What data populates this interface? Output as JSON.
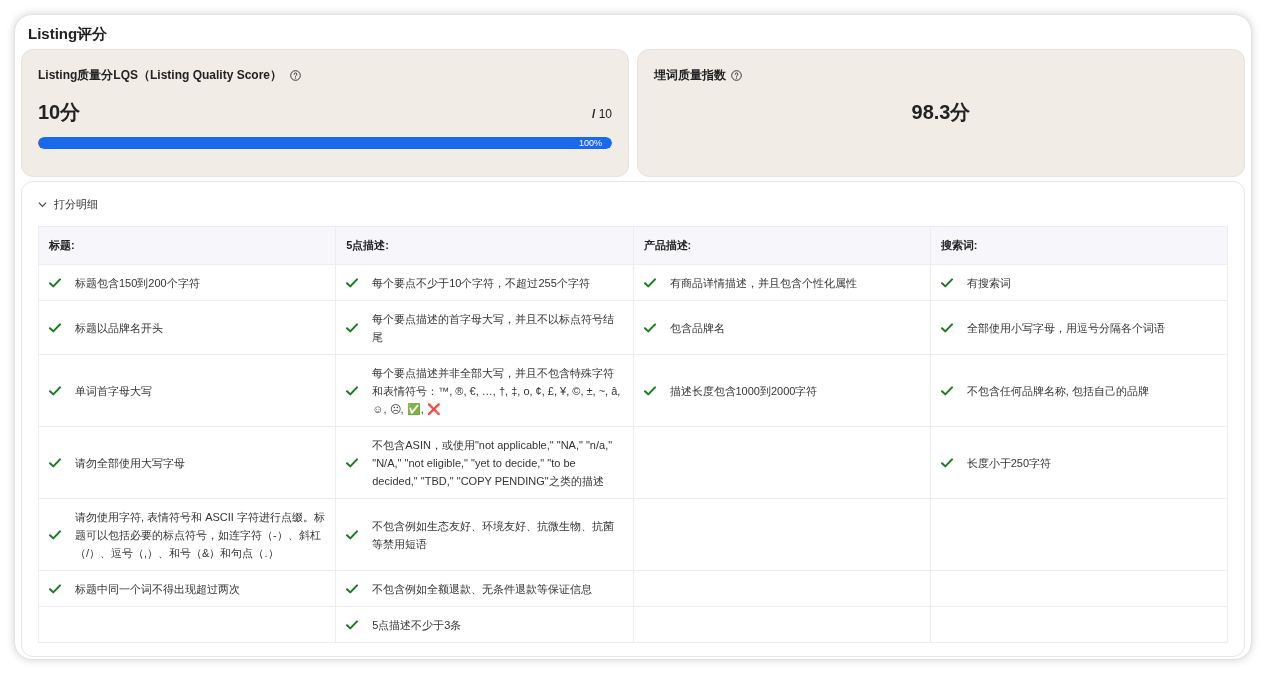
{
  "section_title": "Listing评分",
  "score_cards": [
    {
      "kind": "progress",
      "title": "Listing质量分LQS（Listing Quality Score）",
      "score": "10分",
      "max": "**/** 10",
      "level": 1,
      "level_label": "100%"
    },
    {
      "kind": "value",
      "title": "埋词质量指数",
      "score": "98.3分"
    }
  ],
  "detail": {
    "toggle_label": "打分明细",
    "expanded": true,
    "columns": [
      {
        "heading": "标题:",
        "items": [
          {
            "text": "标题包含150到200个字符",
            "passed": true
          },
          {
            "text": "标题以品牌名开头",
            "passed": true
          },
          {
            "text": "单词首字母大写",
            "passed": true
          },
          {
            "text": "请勿全部使用大写字母",
            "passed": true
          },
          {
            "text": "请勿使用字符, 表情符号和 ASCII 字符进行点缀。标题可以包括必要的标点符号，如连字符（-）、斜杠（/）、逗号（,）、和号（&）和句点（.）",
            "passed": true
          },
          {
            "text": "标题中同一个词不得出现超过两次",
            "passed": true
          }
        ]
      },
      {
        "heading": "5点描述:",
        "items": [
          {
            "text": "每个要点不少于10个字符，不超过255个字符",
            "passed": true
          },
          {
            "text": "每个要点描述的首字母大写，并且不以标点符号结尾",
            "passed": true
          },
          {
            "text": "每个要点描述并非全部大写，并且不包含特殊字符和表情符号：™, ®, €, …, †, ‡, o, ¢, £, ¥, ©, ±, ~, â, ☺, ☹, ✅, ❌",
            "passed": true
          },
          {
            "text": "不包含ASIN，或使用\"not applicable,\" \"NA,\" \"n/a,\" \"N/A,\" \"not eligible,\" \"yet to decide,\" \"to be decided,\" \"TBD,\" \"COPY PENDING\"之类的描述",
            "passed": true
          },
          {
            "text": "不包含例如生态友好、环境友好、抗微生物、抗菌等禁用短语",
            "passed": true
          },
          {
            "text": "不包含例如全额退款、无条件退款等保证信息",
            "passed": true
          },
          {
            "text": "5点描述不少于3条",
            "passed": true
          }
        ]
      },
      {
        "heading": "产品描述:",
        "items": [
          {
            "text": "有商品详情描述，并且包含个性化属性",
            "passed": true
          },
          {
            "text": "包含品牌名",
            "passed": true
          },
          {
            "text": "描述长度包含1000到2000字符",
            "passed": true
          }
        ]
      },
      {
        "heading": "搜索词:",
        "items": [
          {
            "text": "有搜索词",
            "passed": true
          },
          {
            "text": "全部使用小写字母，用逗号分隔各个词语",
            "passed": true
          },
          {
            "text": "不包含任何品牌名称, 包括自己的品牌",
            "passed": true
          },
          {
            "text": "长度小于250字符",
            "passed": true
          }
        ]
      }
    ]
  }
}
